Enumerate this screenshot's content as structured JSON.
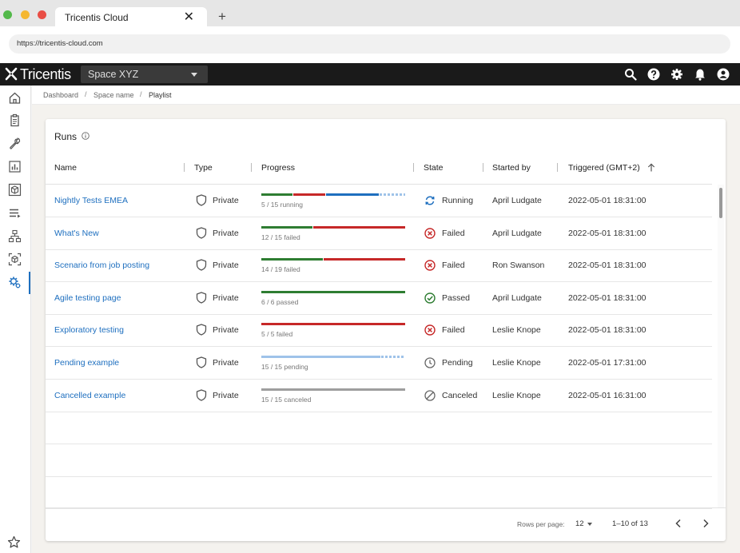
{
  "browser": {
    "tab_title": "Tricentis Cloud",
    "tab_close": "✕",
    "new_tab": "+",
    "url": "https://tricentis-cloud.com"
  },
  "app": {
    "logo_text": "Tricentis",
    "space_selector": "Space XYZ",
    "header_icons": [
      "search-icon",
      "help-icon",
      "settings-icon",
      "notifications-icon",
      "account-icon"
    ]
  },
  "sidebar": {
    "items": [
      "home-icon",
      "test-cases-icon",
      "tools-icon",
      "reports-icon",
      "packages-icon",
      "playlists-icon",
      "hierarchy-icon",
      "components-icon",
      "automation-settings-icon"
    ],
    "active_index": 8,
    "bottom": "favorites-icon"
  },
  "breadcrumb": {
    "items": [
      "Dashboard",
      "Space name",
      "Playlist"
    ],
    "separator": "/"
  },
  "runs": {
    "title": "Runs",
    "columns": [
      "Name",
      "Type",
      "Progress",
      "State",
      "Started by",
      "Triggered (GMT+2)"
    ],
    "rows": [
      {
        "name": "Nightly Tests EMEA",
        "type": "Private",
        "progress_text": "5 / 15 running",
        "state": "Running",
        "started_by": "April Ludgate",
        "triggered": "2022-05-01 18:31:00",
        "segments": [
          {
            "status": "passed",
            "frac": 0.22
          },
          {
            "status": "failed",
            "frac": 0.23
          },
          {
            "status": "running",
            "frac": 0.37
          },
          {
            "status": "pending",
            "frac": 0.18
          }
        ]
      },
      {
        "name": "What's New",
        "type": "Private",
        "progress_text": "12 / 15 failed",
        "state": "Failed",
        "started_by": "April Ludgate",
        "triggered": "2022-05-01 18:31:00",
        "segments": [
          {
            "status": "passed",
            "frac": 0.36
          },
          {
            "status": "failed",
            "frac": 0.64
          }
        ]
      },
      {
        "name": "Scenario from  job posting",
        "type": "Private",
        "progress_text": "14 / 19 failed",
        "state": "Failed",
        "started_by": "Ron Swanson",
        "triggered": "2022-05-01 18:31:00",
        "segments": [
          {
            "status": "passed",
            "frac": 0.43
          },
          {
            "status": "failed",
            "frac": 0.57
          }
        ]
      },
      {
        "name": "Agile testing page",
        "type": "Private",
        "progress_text": "6 / 6 passed",
        "state": "Passed",
        "started_by": "April Ludgate",
        "triggered": "2022-05-01 18:31:00",
        "segments": [
          {
            "status": "passed",
            "frac": 1.0
          }
        ]
      },
      {
        "name": "Exploratory testing",
        "type": "Private",
        "progress_text": "5 / 5 failed",
        "state": "Failed",
        "started_by": "Leslie Knope",
        "triggered": "2022-05-01 18:31:00",
        "segments": [
          {
            "status": "failed",
            "frac": 1.0
          }
        ]
      },
      {
        "name": "Pending example",
        "type": "Private",
        "progress_text": "15 / 15 pending",
        "state": "Pending",
        "started_by": "Leslie Knope",
        "triggered": "2022-05-01 17:31:00",
        "segments": [
          {
            "status": "pending-solid",
            "frac": 0.83
          },
          {
            "status": "pending",
            "frac": 0.17
          }
        ]
      },
      {
        "name": "Cancelled example",
        "type": "Private",
        "progress_text": "15 / 15 canceled",
        "state": "Canceled",
        "started_by": "Leslie Knope",
        "triggered": "2022-05-01 16:31:00",
        "segments": [
          {
            "status": "canceled",
            "frac": 1.0
          }
        ]
      }
    ],
    "empty_rows": 3
  },
  "pagination": {
    "rows_per_page_label": "Rows per page:",
    "rows_per_page": "12",
    "range": "1–10 of 13"
  },
  "colors": {
    "link": "#1e6fbf",
    "passed": "#2e7d32",
    "failed": "#c62828",
    "running": "#1e6fbf",
    "pending": "#9fc3e9",
    "canceled": "#9e9e9e",
    "appbar": "#1a1a1a"
  }
}
